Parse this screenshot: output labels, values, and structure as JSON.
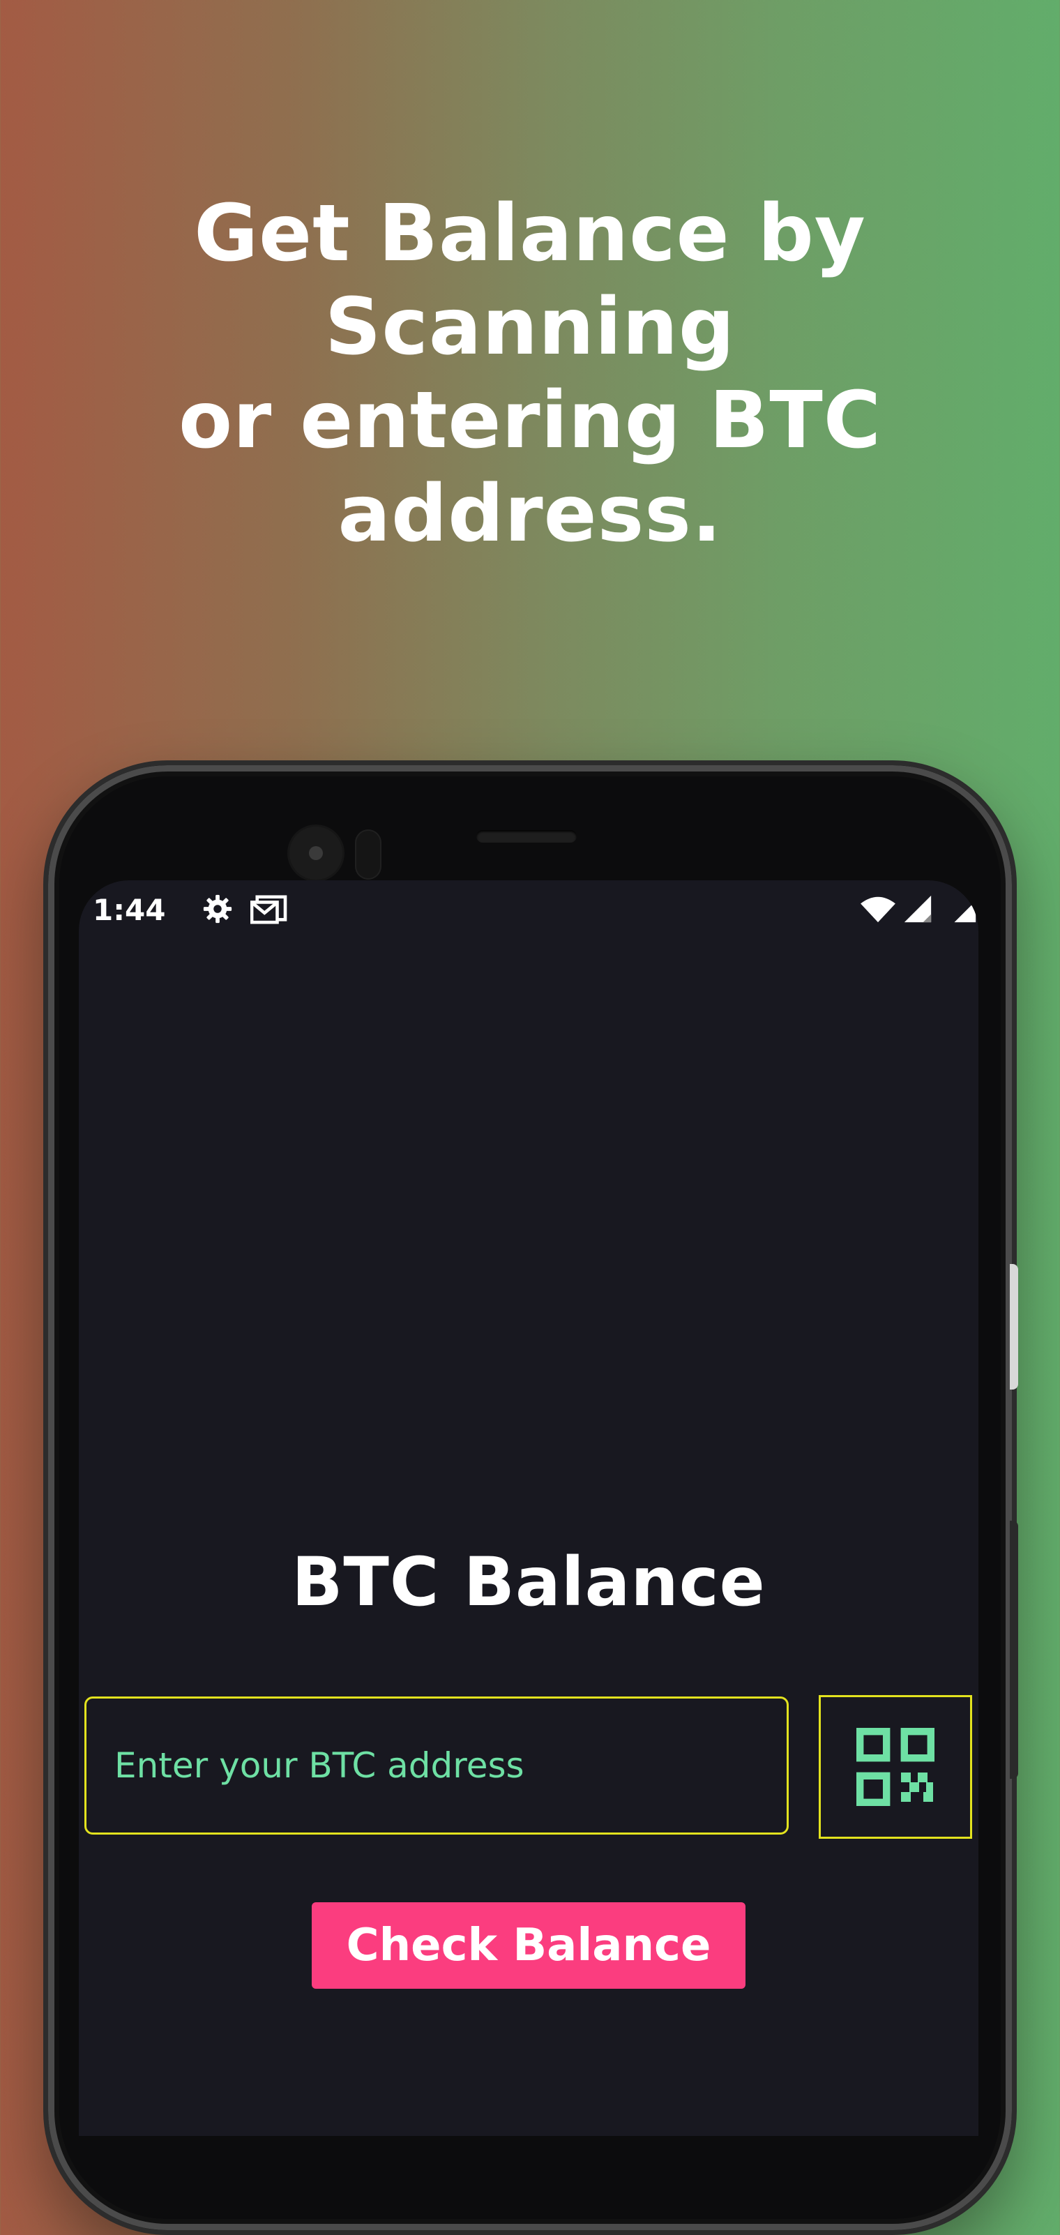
{
  "headline": {
    "lines": [
      "Get Balance by",
      "Scanning",
      "or entering BTC",
      "address."
    ]
  },
  "status_bar": {
    "time": "1:44",
    "left_icons": [
      "gear-icon",
      "mail-icon"
    ],
    "right_icons": [
      "wifi-icon",
      "cellular-signal-icon",
      "battery-icon"
    ]
  },
  "app": {
    "title": "BTC Balance",
    "address_placeholder": "Enter your BTC address",
    "address_value": "",
    "scan_button_icon": "qr-code-icon",
    "check_button_label": "Check Balance"
  },
  "colors": {
    "screen_background": "#181820",
    "input_border": "#e2e21e",
    "accent_green": "#6ee0a4",
    "button_pink": "#fb3d7f"
  }
}
